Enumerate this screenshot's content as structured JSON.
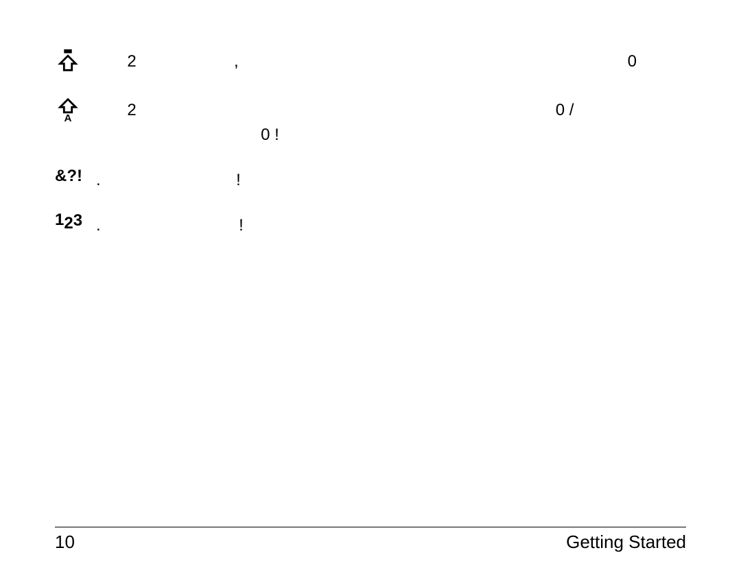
{
  "rows": [
    {
      "icon": "caps-lock-icon",
      "description_visible": "2 , 0",
      "digit_a": "2",
      "punct_a": ",",
      "digit_b": "0"
    },
    {
      "icon": "shift-a-icon",
      "description_visible": "2 0 / 0 !",
      "digit_a": "2",
      "digit_b": "0",
      "punct_b": "/",
      "digit_c": "0",
      "bang": "!"
    },
    {
      "icon": "symbols-icon",
      "icon_text": "&?!",
      "description_visible": ". !",
      "punct_a": ".",
      "bang": "!"
    },
    {
      "icon": "numbers-icon",
      "icon_text": "123",
      "description_visible": ". !",
      "punct_a": ".",
      "bang": "!"
    }
  ],
  "footer": {
    "page_number": "10",
    "chapter": "Getting Started"
  }
}
